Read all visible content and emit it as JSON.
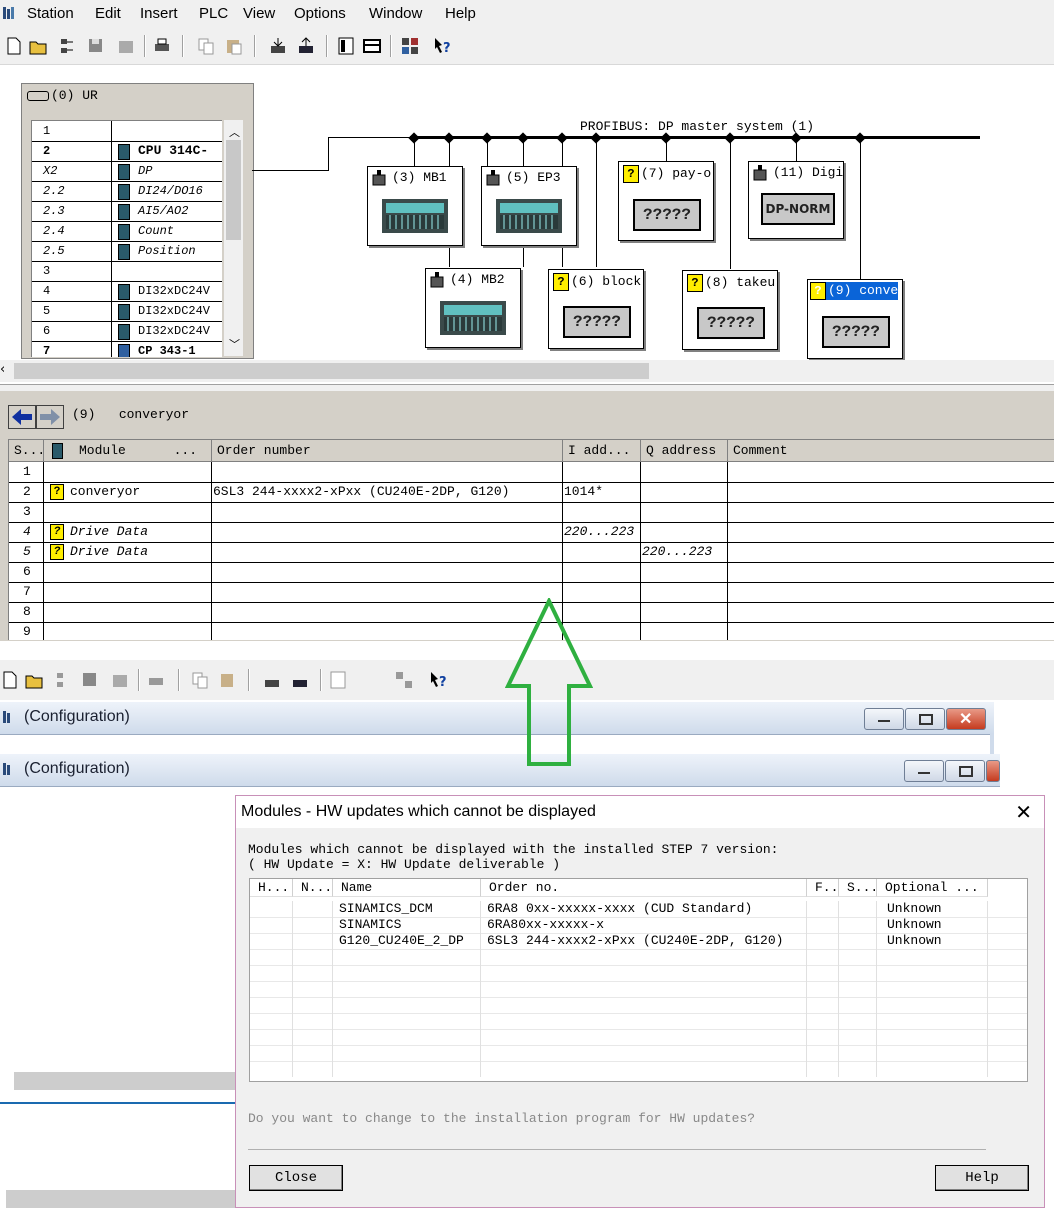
{
  "menu": {
    "items": [
      "Station",
      "Edit",
      "Insert",
      "PLC",
      "View",
      "Options",
      "Window",
      "Help"
    ]
  },
  "toolbar": {
    "icons": [
      "new-icon",
      "open-icon",
      "network-icon",
      "save-icon",
      "compile-icon",
      "print-icon",
      "copy-icon",
      "paste-icon",
      "download-icon",
      "upload-icon",
      "catalog-icon",
      "view-icon",
      "module-info-icon",
      "help-icon"
    ]
  },
  "rack": {
    "title": "(0) UR",
    "rows": [
      {
        "slot": "1",
        "module": ""
      },
      {
        "slot": "2",
        "module": "CPU 314C-"
      },
      {
        "slot": "X2",
        "module": "DP"
      },
      {
        "slot": "2.2",
        "module": "DI24/DO16"
      },
      {
        "slot": "2.3",
        "module": "AI5/AO2"
      },
      {
        "slot": "2.4",
        "module": "Count"
      },
      {
        "slot": "2.5",
        "module": "Position"
      },
      {
        "slot": "3",
        "module": ""
      },
      {
        "slot": "4",
        "module": "DI32xDC24V"
      },
      {
        "slot": "5",
        "module": "DI32xDC24V"
      },
      {
        "slot": "6",
        "module": "DI32xDC24V"
      },
      {
        "slot": "7",
        "module": "CP 343-1"
      }
    ]
  },
  "profibus": {
    "label": "PROFIBUS: DP master system (1)",
    "devices": [
      {
        "label": "(3) MB1"
      },
      {
        "label": "(5) EP3"
      },
      {
        "label": "(7) pay-o",
        "box": "?????"
      },
      {
        "label": "(11) Digi",
        "box": "DP-NORM"
      },
      {
        "label": "(4) MB2"
      },
      {
        "label": "(6) block",
        "box": "?????"
      },
      {
        "label": "(8) takeu",
        "box": "?????"
      },
      {
        "label": "(9) conve",
        "box": "?????"
      }
    ]
  },
  "detail": {
    "station_no": "(9)",
    "station_name": "converyor",
    "headers": [
      "S...",
      "Module",
      "...",
      "Order number",
      "I add...",
      "Q address",
      "Comment"
    ],
    "rows": [
      {
        "slot": "1",
        "module": "",
        "order": "",
        "iaddr": "",
        "qaddr": ""
      },
      {
        "slot": "2",
        "module": "converyor",
        "order": "6SL3 244-xxxx2-xPxx (CU240E-2DP, G120)",
        "iaddr": "1014*",
        "qaddr": ""
      },
      {
        "slot": "3",
        "module": "",
        "order": "",
        "iaddr": "",
        "qaddr": ""
      },
      {
        "slot": "4",
        "module": "Drive Data",
        "order": "",
        "iaddr": "220...223",
        "qaddr": ""
      },
      {
        "slot": "5",
        "module": "Drive Data",
        "order": "",
        "iaddr": "",
        "qaddr": "220...223"
      },
      {
        "slot": "6",
        "module": "",
        "order": "",
        "iaddr": "",
        "qaddr": ""
      },
      {
        "slot": "7",
        "module": "",
        "order": "",
        "iaddr": "",
        "qaddr": ""
      },
      {
        "slot": "8",
        "module": "",
        "order": "",
        "iaddr": "",
        "qaddr": ""
      },
      {
        "slot": "9",
        "module": "",
        "order": "",
        "iaddr": "",
        "qaddr": ""
      }
    ]
  },
  "windows": {
    "config1": "(Configuration)",
    "config2": "(Configuration)"
  },
  "dialog": {
    "title": "Modules - HW updates which cannot be displayed",
    "msg1": "Modules which cannot be displayed with the installed STEP 7 version:",
    "msg2": "( HW Update = X:   HW Update deliverable )",
    "headers": [
      "H...",
      "N...",
      "Name",
      "Order no.",
      "F...",
      "S...",
      "Optional ..."
    ],
    "rows": [
      {
        "name": "SINAMICS_DCM",
        "order": "6RA8 0xx-xxxxx-xxxx (CUD Standard)",
        "optional": "Unknown"
      },
      {
        "name": "SINAMICS",
        "order": "6RA80xx-xxxxx-x",
        "optional": "Unknown"
      },
      {
        "name": "G120_CU240E_2_DP",
        "order": "6SL3 244-xxxx2-xPxx (CU240E-2DP, G120)",
        "optional": "Unknown"
      }
    ],
    "question": "Do you want to change to the installation program for HW updates?",
    "close_label": "Close",
    "help_label": "Help"
  },
  "colors": {
    "arrow": "#2fb040",
    "selected_device": "#0a64d8"
  }
}
